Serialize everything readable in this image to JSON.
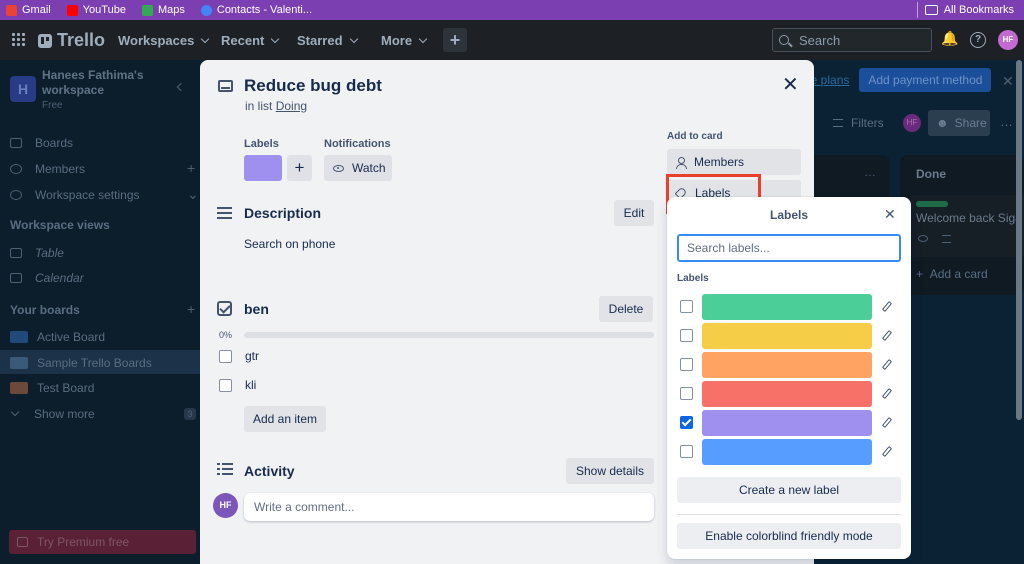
{
  "bookmarks": {
    "items": [
      {
        "label": "Gmail",
        "color": "#ea4335"
      },
      {
        "label": "YouTube",
        "color": "#ff0000"
      },
      {
        "label": "Maps",
        "color": "#34a853"
      },
      {
        "label": "Contacts - Valenti...",
        "color": "#4285f4"
      }
    ],
    "all_label": "All Bookmarks"
  },
  "header": {
    "logo": "Trello",
    "nav": [
      "Workspaces",
      "Recent",
      "Starred",
      "More"
    ],
    "search_placeholder": "Search",
    "avatar": "HF"
  },
  "sidebar": {
    "workspace_initial": "H",
    "workspace_name": "Hanees Fathima's workspace",
    "plan": "Free",
    "items": [
      "Boards",
      "Members",
      "Workspace settings"
    ],
    "views_heading": "Workspace views",
    "views": [
      "Table",
      "Calendar"
    ],
    "boards_heading": "Your boards",
    "boards": [
      {
        "label": "Active Board",
        "color": "#1f4a7a"
      },
      {
        "label": "Sample Trello Boards",
        "color": "#3a5a7a"
      },
      {
        "label": "Test Board",
        "color": "#6b4a3a"
      }
    ],
    "show_more": "Show more",
    "show_more_count": "3",
    "premium": "Try Premium free"
  },
  "board": {
    "banner_link": "ore plans",
    "banner_button": "Add payment method",
    "filters": "Filters",
    "avatar": "HF",
    "share": "Share",
    "done_column": "Done",
    "done_card": "Welcome back Siga",
    "add_card": "Add a card"
  },
  "modal": {
    "title": "Reduce bug debt",
    "in_list_prefix": "in list",
    "list_name": "Doing",
    "labels_heading": "Labels",
    "label_color": "#9f8fef",
    "notifications_heading": "Notifications",
    "watch": "Watch",
    "description_heading": "Description",
    "edit": "Edit",
    "description": "Search on phone",
    "checklist_title": "ben",
    "delete": "Delete",
    "progress_text": "0%",
    "progress": 0,
    "checklist_items": [
      "gtr",
      "kli"
    ],
    "add_item": "Add an item",
    "activity_heading": "Activity",
    "show_details": "Show details",
    "commenter_initials": "HF",
    "comment_placeholder": "Write a comment...",
    "add_to_card": "Add to card",
    "members": "Members",
    "labels_button": "Labels"
  },
  "labels_popover": {
    "title": "Labels",
    "search_placeholder": "Search labels...",
    "subheading": "Labels",
    "labels": [
      {
        "color": "#4bce97",
        "checked": false
      },
      {
        "color": "#f5cd47",
        "checked": false
      },
      {
        "color": "#fea362",
        "checked": false
      },
      {
        "color": "#f87168",
        "checked": false
      },
      {
        "color": "#9f8fef",
        "checked": true
      },
      {
        "color": "#579dff",
        "checked": false
      }
    ],
    "create_button": "Create a new label",
    "colorblind_button": "Enable colorblind friendly mode"
  }
}
